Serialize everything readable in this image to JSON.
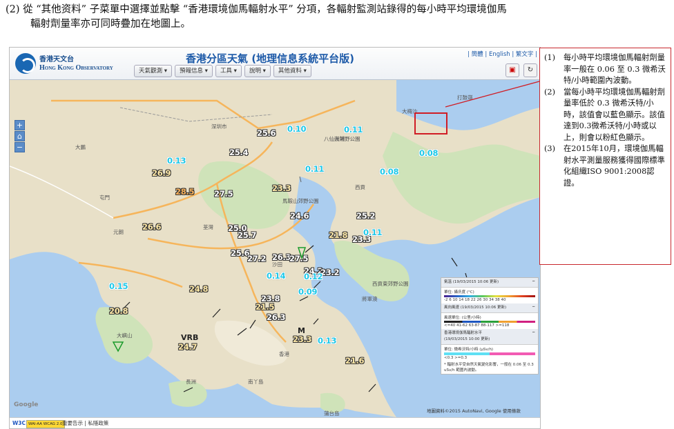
{
  "instruction": {
    "line1": "(2) 從 “其他资料” 子菜單中選擇並點擊 “香港環境伽馬輻射水平” 分項，各輻射監測站錄得的每小時平均環境伽馬",
    "line2": "輻射劑量率亦可同時疊加在地圖上。"
  },
  "app": {
    "logo_zh": "香港天文台",
    "logo_en": "Hong Kong Observatory",
    "title": "香港分區天氣 (地理信息系統平台版)",
    "lang_links": "| 簡體 | English | 繁文字 |",
    "menu": [
      "天氣觀測 ▾",
      "預報信息 ▾",
      "工具 ▾",
      "說明 ▾",
      "其他資料 ▾"
    ],
    "icons": {
      "print": "pdf-icon",
      "refresh": "refresh-icon"
    }
  },
  "map": {
    "zoom": [
      "+",
      "⌂",
      "−"
    ],
    "temperatures": [
      "25.6",
      "25.4",
      "26.9",
      "28.5",
      "27.5",
      "23.3",
      "26.6",
      "25.0",
      "25.7",
      "24.6",
      "25.2",
      "21.8",
      "23.3",
      "25.6",
      "27.2",
      "26.3",
      "27.5",
      "24.8",
      "23.8",
      "21.5",
      "24.2",
      "23.2",
      "26.3",
      "20.8",
      "24.7",
      "23.3",
      "21.6"
    ],
    "radiation": [
      "0.10",
      "0.11",
      "0.11",
      "0.08",
      "0.13",
      "0.08",
      "0.11",
      "0.14",
      "0.12",
      "0.09",
      "0.15",
      "0.13"
    ],
    "highlighted_value": "0.08",
    "station_labels": {
      "vrb": "VRB",
      "m": "M"
    },
    "place_names": [
      "深圳市",
      "大鵬",
      "大埔",
      "西貢",
      "屯門",
      "元朗",
      "荃灣",
      "沙田",
      "將軍澳",
      "香港",
      "大嶼山",
      "長洲",
      "南丫島",
      "蒲台島",
      "打鼓嶺",
      "大梅沙",
      "八仙嶺郊野公園",
      "馬鞍山郊野公園",
      "西貢東郊野公園"
    ],
    "copyright": "地圖資料©2015 AutoNavi, Google  使用條款",
    "google": "Google"
  },
  "legend": {
    "temp_title": "氣溫 (19/03/2015 10:06 更新)",
    "temp_unit": "單位: 攝氏度 (°C)",
    "temp_ticks": "-2  6  10  14  18  22  26  30  34  38  40",
    "wind_title": "風向風速 (19/03/2015 10:06 更新)",
    "wind_unit": "風速單位: (公里/小時)",
    "wind_ticks": "<=40   41-62   63-87   88-117   >=118",
    "rad_title": "香港環境伽馬輻射水平",
    "rad_time": "(19/03/2015 10:00 更新)",
    "rad_unit": "單位: 微希沃特/小時 (μSv/h)",
    "rad_ticks": "<0.3                 >=0.3",
    "rad_note": "* 輻射水平受自然天氣變化影響，一般在 0.06 至 0.3 uSv/h 範圍內波動。",
    "colors": {
      "blue": "#5fe0f4",
      "pink": "#f25bb3"
    }
  },
  "footer": {
    "badges": [
      "W3C",
      "WAI-AA WCAG 2.0"
    ],
    "links": "重要告示 | 私隱政策"
  },
  "callout": [
    {
      "n": "(1)",
      "t": "每小時平均環境伽馬輻射劑量率一般在 0.06 至 0.3 微希沃特/小時範圍內波動。"
    },
    {
      "n": "(2)",
      "t": "當每小時平均環境伽馬輻射劑量率低於 0.3 微希沃特/小時，該值會以藍色顯示。該值達到0.3微希沃特/小時或以上，則會以粉紅色顯示。"
    },
    {
      "n": "(3)",
      "t": "在2015年10月，環境伽馬輻射水平測量服務獲得國際標準化組織ISO 9001:2008認證。"
    }
  ]
}
